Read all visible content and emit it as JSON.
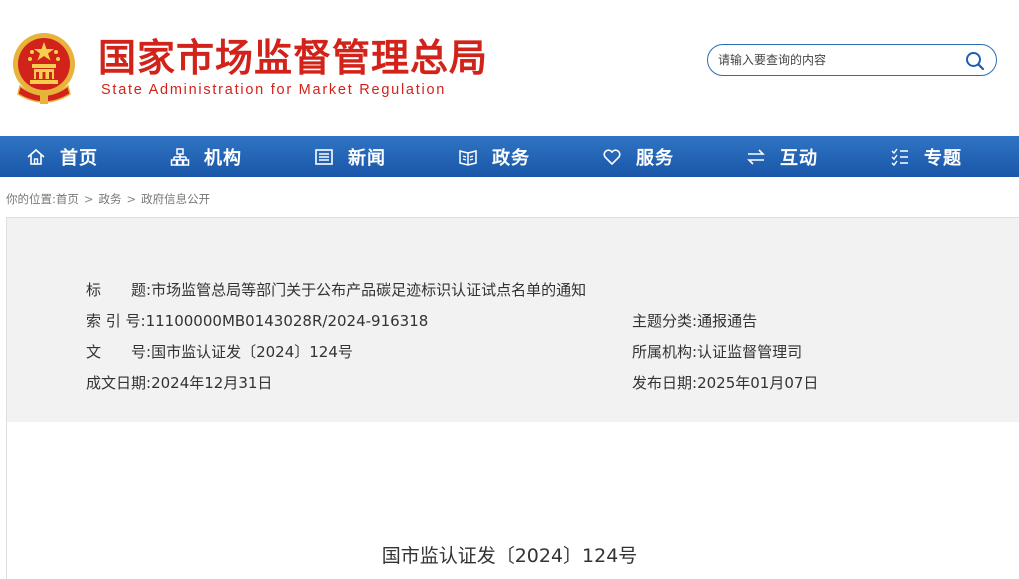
{
  "site": {
    "name_cn": "国家市场监督管理总局",
    "name_en": "State Administration for Market Regulation",
    "emblem_icon": "national-emblem-icon"
  },
  "search": {
    "placeholder": "请输入要查询的内容",
    "icon": "search-icon"
  },
  "nav": {
    "items": [
      {
        "label": "首页",
        "icon": "home-icon"
      },
      {
        "label": "机构",
        "icon": "organization-icon"
      },
      {
        "label": "新闻",
        "icon": "newspaper-icon"
      },
      {
        "label": "政务",
        "icon": "book-icon"
      },
      {
        "label": "服务",
        "icon": "heart-icon"
      },
      {
        "label": "互动",
        "icon": "exchange-icon"
      },
      {
        "label": "专题",
        "icon": "list-icon"
      }
    ]
  },
  "breadcrumb": {
    "prefix": "你的位置:",
    "items": [
      "首页",
      "政务",
      "政府信息公开"
    ],
    "separator": ">"
  },
  "meta": {
    "title_label": "标　　题:",
    "title_value": "市场监管总局等部门关于公布产品碳足迹标识认证试点名单的通知",
    "index_label": "索 引 号:",
    "index_value": "11100000MB0143028R/2024-916318",
    "topic_label": "主题分类:",
    "topic_value": "通报通告",
    "docno_label": "文　　号:",
    "docno_value": "国市监认证发〔2024〕124号",
    "org_label": "所属机构:",
    "org_value": "认证监督管理司",
    "created_label": "成文日期:",
    "created_value": "2024年12月31日",
    "published_label": "发布日期:",
    "published_value": "2025年01月07日"
  },
  "content": {
    "doc_number": "国市监认证发〔2024〕124号"
  },
  "colors": {
    "brand_red": "#d2231b",
    "nav_blue": "#1f5eae",
    "search_border": "#2d6cb5",
    "meta_bg": "#f2f2f2"
  }
}
